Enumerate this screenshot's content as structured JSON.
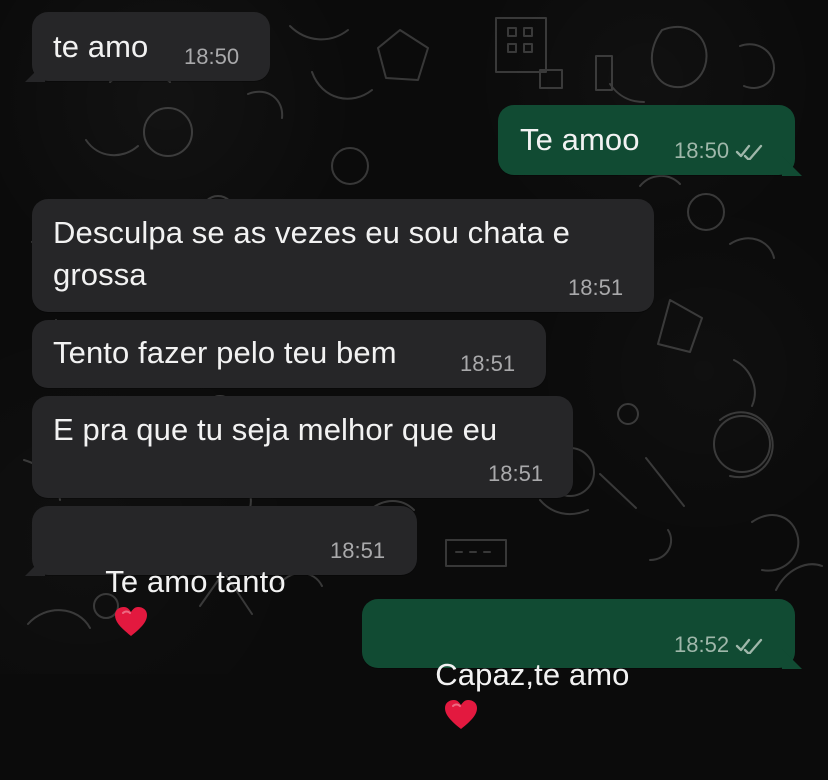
{
  "messages": [
    {
      "text": "te amo",
      "time": "18:50",
      "direction": "incoming"
    },
    {
      "text": "Te amoo",
      "time": "18:50",
      "direction": "outgoing",
      "status_icon": "double-check-icon"
    },
    {
      "text": "Desculpa se as vezes eu sou chata e\ngrossa",
      "time": "18:51",
      "direction": "incoming"
    },
    {
      "text": "Tento fazer pelo teu bem",
      "time": "18:51",
      "direction": "incoming"
    },
    {
      "text": "E pra que tu seja melhor que eu",
      "time": "18:51",
      "direction": "incoming"
    },
    {
      "text": "Te amo tanto",
      "time": "18:51",
      "direction": "incoming",
      "emoji": "heart-icon"
    },
    {
      "text": "Capaz,te amo",
      "time": "18:52",
      "direction": "outgoing",
      "emoji": "heart-icon",
      "status_icon": "double-check-icon"
    }
  ],
  "colors": {
    "background": "#0b0b0b",
    "incoming_bubble": "#262628",
    "outgoing_bubble": "#114b33",
    "text": "#f2f2f2",
    "meta_incoming": "#a9a9ab",
    "meta_outgoing": "#9fb7aa",
    "heart": "#e3193f"
  }
}
